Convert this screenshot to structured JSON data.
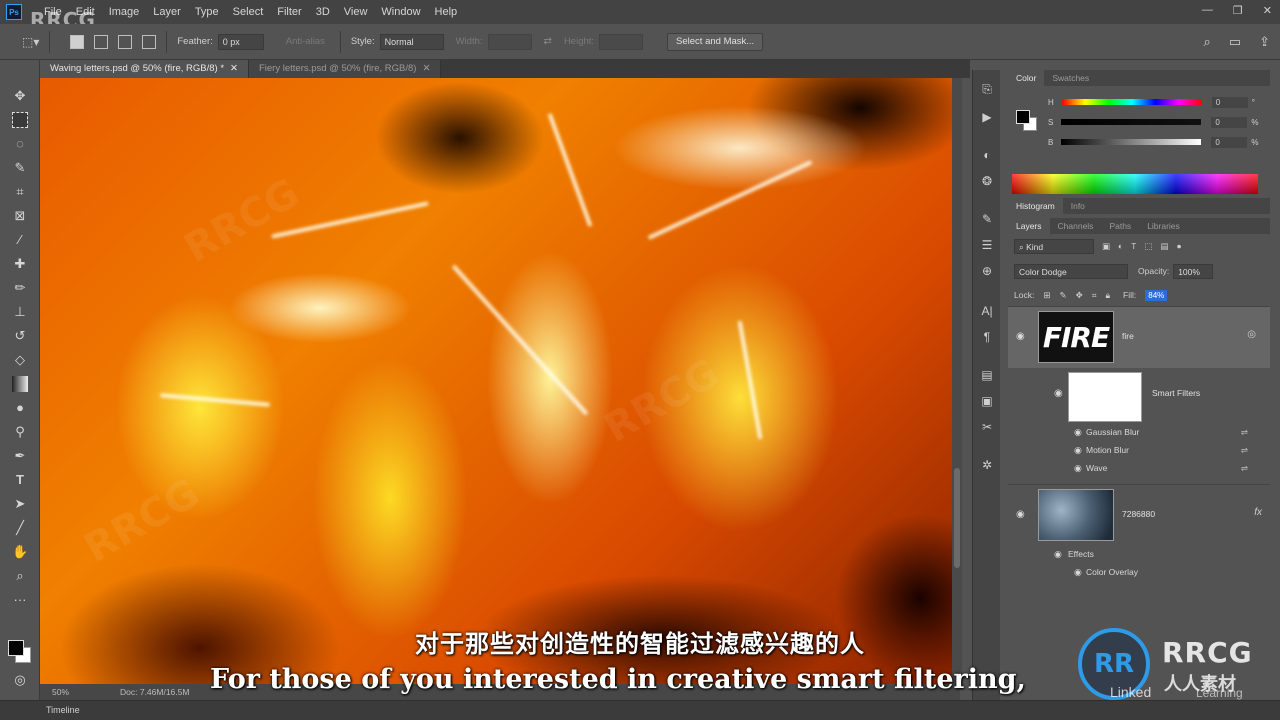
{
  "app": {
    "logo": "Ps",
    "menu": [
      "File",
      "Edit",
      "Image",
      "Layer",
      "Type",
      "Select",
      "Filter",
      "3D",
      "View",
      "Window",
      "Help"
    ]
  },
  "options_bar": {
    "feather_label": "Feather:",
    "feather_value": "0 px",
    "antialias_label": "Anti-alias",
    "style_label": "Style:",
    "style_value": "Normal",
    "width_label": "Width:",
    "height_label": "Height:",
    "select_mask_button": "Select and Mask..."
  },
  "tabs": [
    {
      "label": "Waving letters.psd @ 50% (fire, RGB/8) *",
      "active": true
    },
    {
      "label": "Fiery letters.psd @ 50% (fire, RGB/8)",
      "active": false
    }
  ],
  "status": {
    "zoom": "50%",
    "doc": "Doc: 7.46M/16.5M"
  },
  "timeline_label": "Timeline",
  "color_panel": {
    "tabs": [
      "Color",
      "Swatches"
    ],
    "sliders": [
      {
        "label": "H",
        "value": "0",
        "unit": "°"
      },
      {
        "label": "S",
        "value": "0",
        "unit": "%"
      },
      {
        "label": "B",
        "value": "0",
        "unit": "%"
      }
    ]
  },
  "histogram_tabs": [
    "Histogram",
    "Info"
  ],
  "layers_panel": {
    "tabs": [
      "Layers",
      "Channels",
      "Paths",
      "Libraries"
    ],
    "kind_label": "Kind",
    "blend_mode": "Color Dodge",
    "opacity_label": "Opacity:",
    "opacity_value": "100%",
    "lock_label": "Lock:",
    "fill_label": "Fill:",
    "fill_value": "84%",
    "layers": [
      {
        "name": "fire",
        "thumb_text": "FIRE"
      },
      {
        "name": "Smart Filters"
      },
      {
        "name": "7286880"
      }
    ],
    "filters": [
      "Gaussian Blur",
      "Motion Blur",
      "Wave"
    ],
    "effects_label": "Effects",
    "effect_items": [
      "Color Overlay"
    ],
    "fx": "fx"
  },
  "subtitles": {
    "chinese": "对于那些对创造性的智能过滤感兴趣的人",
    "english": "For those of you interested in creative smart filtering,"
  },
  "watermarks": {
    "corner": "RRCG",
    "logo": "RR",
    "brand": "RRCG",
    "brand_cn": "人人素材",
    "linkedin": "Linked",
    "learning": "Learning"
  }
}
